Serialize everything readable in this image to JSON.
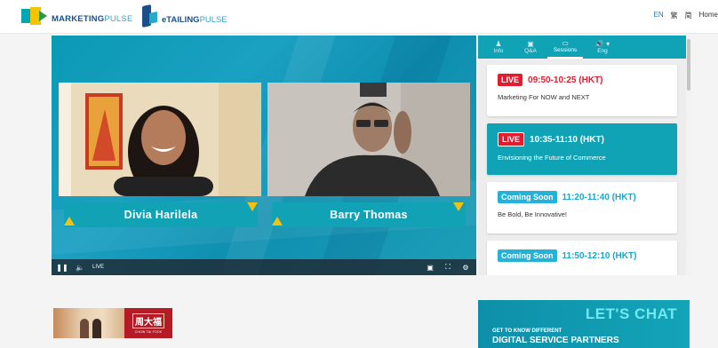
{
  "header": {
    "logo_marketing_bold": "MARKETING",
    "logo_marketing_thin": "PULSE",
    "logo_etailing_bold": "eTAILING",
    "logo_etailing_thin": "PULSE",
    "langs": [
      "EN",
      "繁",
      "简",
      "Home"
    ]
  },
  "video": {
    "speakers": [
      {
        "name": "Divia Harilela"
      },
      {
        "name": "Barry Thomas"
      }
    ],
    "controls": {
      "live_label": "LIVE"
    }
  },
  "panel": {
    "tabs": [
      {
        "label": "Info",
        "icon": "people-icon"
      },
      {
        "label": "Q&A",
        "icon": "chat-icon"
      },
      {
        "label": "Sessions",
        "icon": "monitor-icon"
      },
      {
        "label": "Eng",
        "icon": "volume-icon"
      }
    ],
    "active_tab": "Sessions",
    "sessions": [
      {
        "badge": "LIVE",
        "time": "09:50-10:25 (HKT)",
        "title": "Marketing For NOW and NEXT"
      },
      {
        "badge": "LIVE",
        "time": "10:35-11:10 (HKT)",
        "title": "Envisioning the Future of Commerce"
      },
      {
        "badge": "Coming Soon",
        "time": "11:20-11:40 (HKT)",
        "title": "Be Bold, Be Innovative!"
      },
      {
        "badge": "Coming Soon",
        "time": "11:50-12:10 (HKT)",
        "title": ""
      }
    ]
  },
  "ads": {
    "left": {
      "brand_cn": "周大福",
      "brand_en": "CHOW TAI FOOK"
    },
    "right": {
      "headline": "LET'S CHAT",
      "line1": "GET TO KNOW DIFFERENT",
      "line2": "DIGITAL SERVICE PARTNERS"
    }
  },
  "colors": {
    "teal": "#10a2b5",
    "live_red": "#e51a2e",
    "coming_soon_blue": "#25b2d8"
  }
}
